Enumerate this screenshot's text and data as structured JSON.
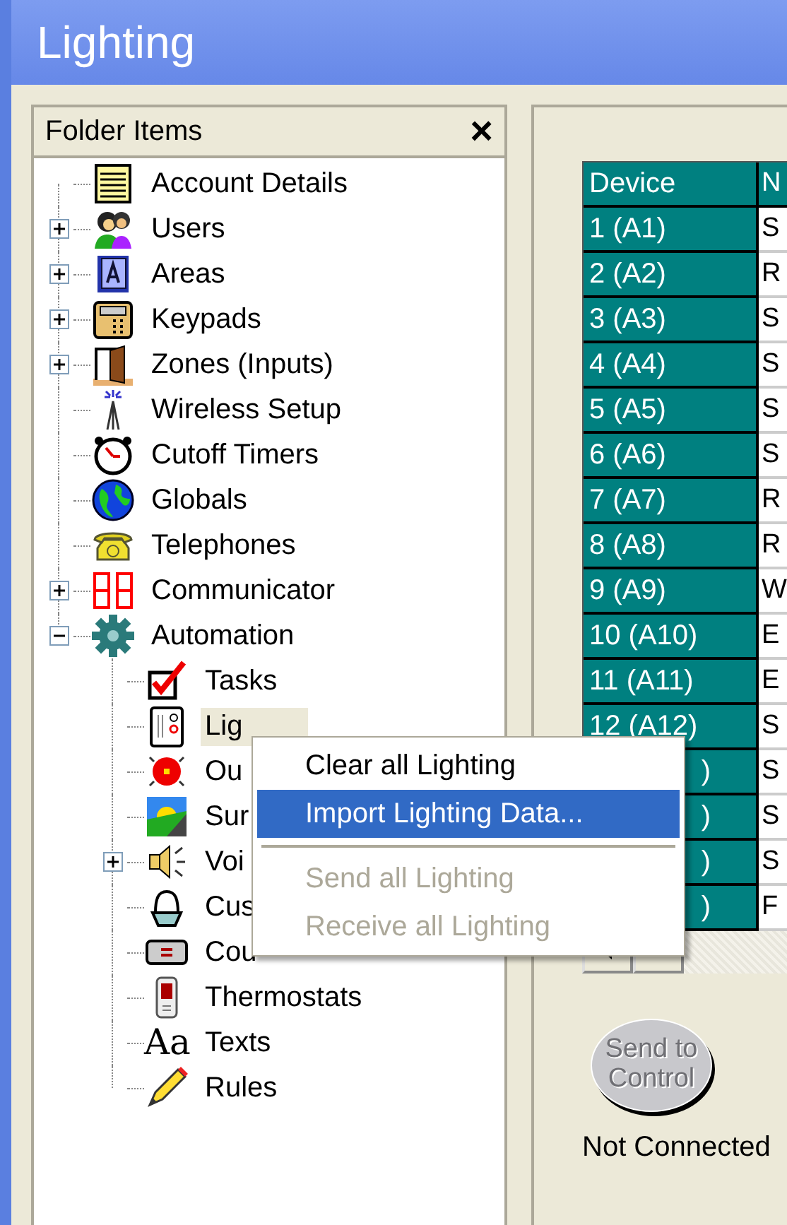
{
  "window": {
    "title": "Lighting"
  },
  "folder_panel": {
    "title": "Folder Items",
    "close": "×"
  },
  "tree": [
    {
      "label": "Account Details",
      "kind": "leaf",
      "selected": false
    },
    {
      "label": "Users",
      "kind": "group",
      "expanded": false,
      "selected": false
    },
    {
      "label": "Areas",
      "kind": "group",
      "expanded": false,
      "selected": false
    },
    {
      "label": "Keypads",
      "kind": "group",
      "expanded": false,
      "selected": false
    },
    {
      "label": "Zones (Inputs)",
      "kind": "group",
      "expanded": false,
      "selected": false
    },
    {
      "label": "Wireless Setup",
      "kind": "leaf",
      "selected": false
    },
    {
      "label": "Cutoff Timers",
      "kind": "leaf",
      "selected": false
    },
    {
      "label": "Globals",
      "kind": "leaf",
      "selected": false
    },
    {
      "label": "Telephones",
      "kind": "leaf",
      "selected": false
    },
    {
      "label": "Communicator",
      "kind": "group",
      "expanded": false,
      "selected": false
    },
    {
      "label": "Automation",
      "kind": "group",
      "expanded": true,
      "selected": false,
      "children": [
        {
          "label": "Tasks",
          "kind": "leaf",
          "selected": false
        },
        {
          "label": "Lig",
          "kind": "leaf",
          "selected": true
        },
        {
          "label": "Ou",
          "kind": "leaf",
          "selected": false
        },
        {
          "label": "Sur",
          "kind": "leaf",
          "selected": false
        },
        {
          "label": "Voi",
          "kind": "group",
          "expanded": false,
          "selected": false
        },
        {
          "label": "Cus",
          "kind": "leaf",
          "selected": false
        },
        {
          "label": "Cou",
          "kind": "leaf",
          "selected": false
        },
        {
          "label": "Thermostats",
          "kind": "leaf",
          "selected": false
        },
        {
          "label": "Texts",
          "kind": "leaf",
          "selected": false,
          "icon_text": "Aa"
        },
        {
          "label": "Rules",
          "kind": "leaf",
          "selected": false
        }
      ]
    }
  ],
  "grid": {
    "columns": [
      "Device",
      "N"
    ],
    "rows": [
      {
        "device": "1 (A1)",
        "column_2": "S"
      },
      {
        "device": "2 (A2)",
        "column_2": "R"
      },
      {
        "device": "3 (A3)",
        "column_2": "S"
      },
      {
        "device": "4 (A4)",
        "column_2": "S"
      },
      {
        "device": "5 (A5)",
        "column_2": "S"
      },
      {
        "device": "6 (A6)",
        "column_2": "S"
      },
      {
        "device": "7 (A7)",
        "column_2": "R"
      },
      {
        "device": "8 (A8)",
        "column_2": "R"
      },
      {
        "device": "9 (A9)",
        "column_2": "W"
      },
      {
        "device": "10 (A10)",
        "column_2": "E"
      },
      {
        "device": "11 (A11)",
        "column_2": "E"
      },
      {
        "device": "12 (A12)",
        "column_2": "S"
      },
      {
        "device": ")",
        "column_2": "S",
        "kind": "covered"
      },
      {
        "device": ")",
        "column_2": "S",
        "kind": "covered"
      },
      {
        "device": ")",
        "column_2": "S",
        "kind": "covered"
      },
      {
        "device": ")",
        "column_2": "F",
        "kind": "covered"
      }
    ]
  },
  "send_button": {
    "label": "Send to Control",
    "disabled": true
  },
  "status": "Not Connected",
  "context_menu": {
    "items": [
      {
        "kind": "command",
        "label": "Clear all Lighting",
        "selected": false,
        "disabled": false
      },
      {
        "kind": "command",
        "label": "Import Lighting Data...",
        "selected": true,
        "disabled": false
      },
      {
        "kind": "separator"
      },
      {
        "kind": "command",
        "label": "Send all Lighting",
        "selected": false,
        "disabled": true
      },
      {
        "kind": "command",
        "label": "Receive all Lighting",
        "selected": false,
        "disabled": true
      }
    ]
  }
}
